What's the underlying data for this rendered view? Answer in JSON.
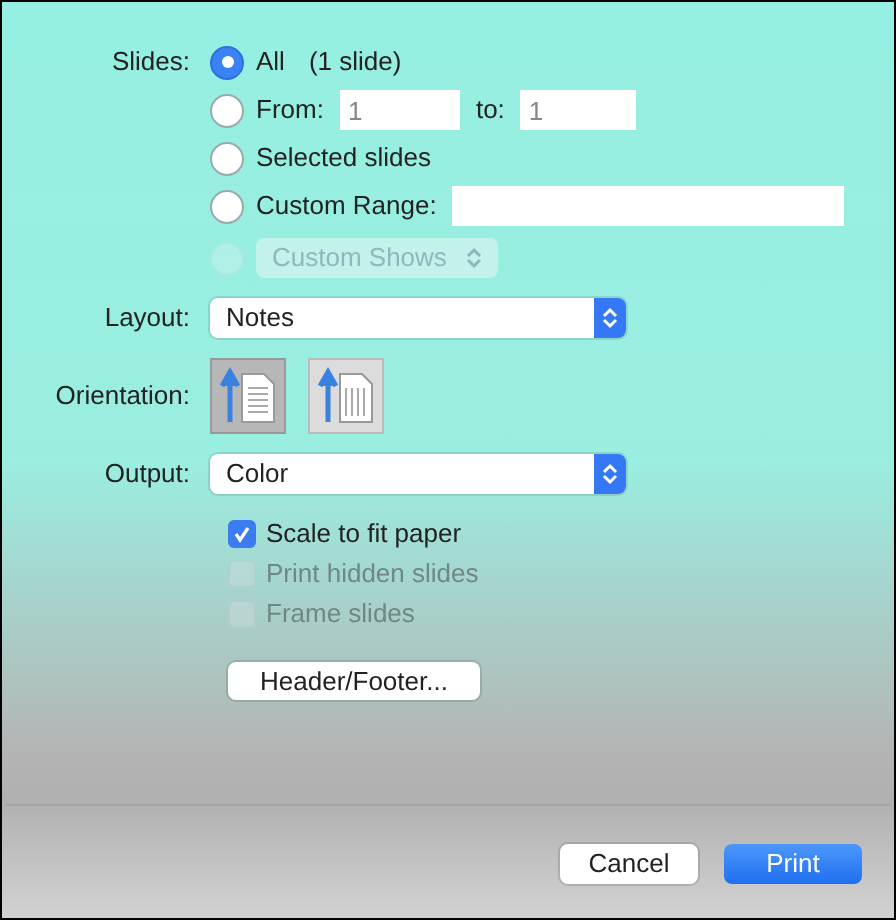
{
  "slides": {
    "label": "Slides:",
    "options": [
      {
        "kind": "all",
        "label": "All",
        "note": "(1 slide)",
        "selected": true,
        "disabled": false
      },
      {
        "kind": "range",
        "label": "From:",
        "from": "1",
        "to_label": "to:",
        "to": "1",
        "selected": false,
        "disabled": false
      },
      {
        "kind": "plain",
        "label": "Selected slides",
        "selected": false,
        "disabled": false
      },
      {
        "kind": "custom",
        "label": "Custom Range:",
        "selected": false,
        "disabled": false
      },
      {
        "kind": "shows",
        "popup": "Custom Shows",
        "selected": false,
        "disabled": true
      }
    ]
  },
  "layout": {
    "label": "Layout:",
    "value": "Notes"
  },
  "orientation": {
    "label": "Orientation:",
    "options": [
      {
        "kind": "portrait",
        "selected": true
      },
      {
        "kind": "landscape",
        "selected": false
      }
    ]
  },
  "output": {
    "label": "Output:",
    "value": "Color"
  },
  "checkboxes": [
    {
      "label": "Scale to fit paper",
      "checked": true,
      "disabled": false
    },
    {
      "label": "Print hidden slides",
      "checked": false,
      "disabled": true
    },
    {
      "label": "Frame slides",
      "checked": false,
      "disabled": true
    }
  ],
  "header_footer_button": "Header/Footer...",
  "buttons": [
    {
      "label": "Cancel",
      "primary": false
    },
    {
      "label": "Print",
      "primary": true
    }
  ]
}
